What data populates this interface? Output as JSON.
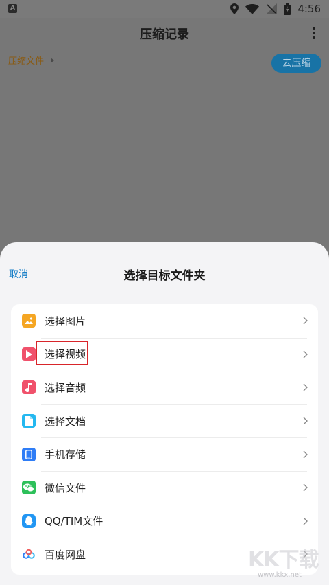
{
  "status_bar": {
    "time": "4:56"
  },
  "app_bar": {
    "title": "压缩记录"
  },
  "breadcrumb": {
    "label": "压缩文件"
  },
  "compress_button": {
    "label": "去压缩"
  },
  "sheet": {
    "cancel_label": "取消",
    "title": "选择目标文件夹",
    "items": [
      {
        "label": "选择图片",
        "icon": "image-icon",
        "color": "#f5a623"
      },
      {
        "label": "选择视频",
        "icon": "video-icon",
        "color": "#f0516b"
      },
      {
        "label": "选择音频",
        "icon": "music-icon",
        "color": "#f0516b"
      },
      {
        "label": "选择文档",
        "icon": "document-icon",
        "color": "#24b8f0"
      },
      {
        "label": "手机存储",
        "icon": "phone-icon",
        "color": "#2f7df6"
      },
      {
        "label": "微信文件",
        "icon": "wechat-icon",
        "color": "#2dc05a"
      },
      {
        "label": "QQ/TIM文件",
        "icon": "qq-icon",
        "color": "#2196f3"
      },
      {
        "label": "百度网盘",
        "icon": "baidu-netdisk-icon",
        "color": "#2d7ef5"
      }
    ]
  },
  "watermark": {
    "big": "KK下载",
    "small": "www.kkx.net"
  }
}
